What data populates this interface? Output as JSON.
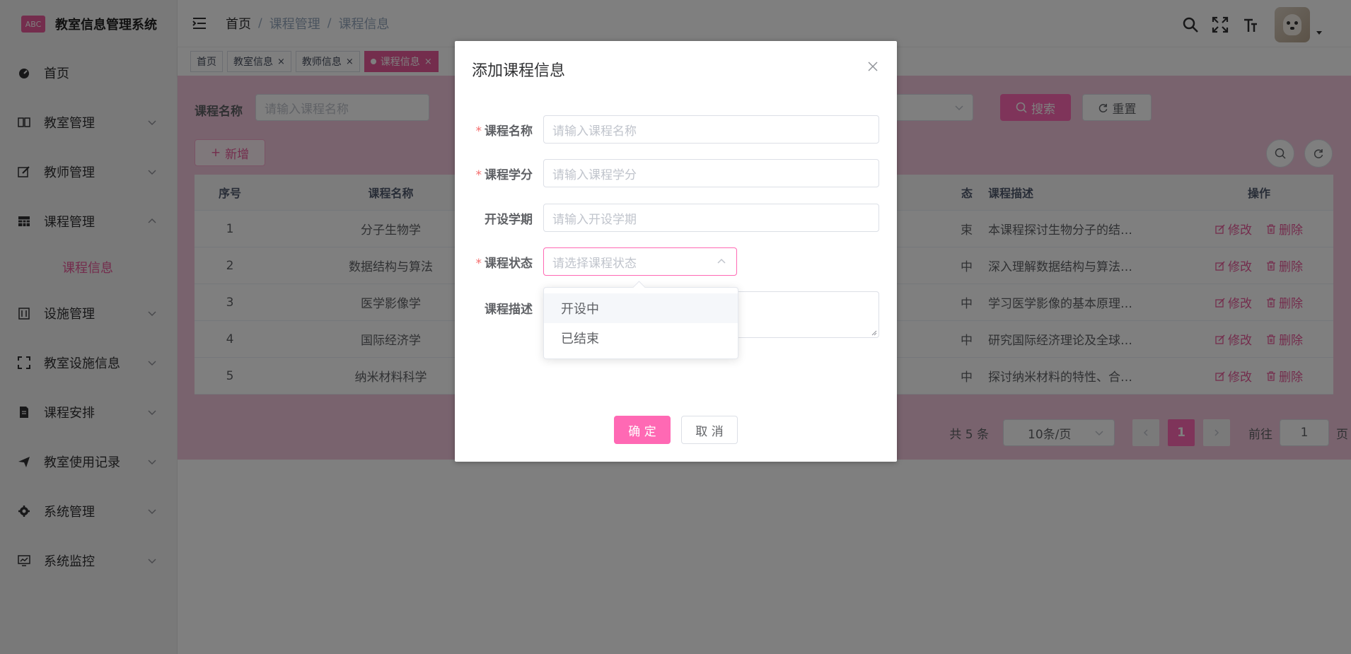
{
  "sidebar": {
    "logo_mark": "ABC",
    "title": "教室信息管理系统",
    "items": [
      {
        "label": "首页",
        "icon": "dashboard-icon"
      },
      {
        "label": "教室管理",
        "icon": "book-icon"
      },
      {
        "label": "教师管理",
        "icon": "edit-icon"
      },
      {
        "label": "课程管理",
        "icon": "table-icon"
      },
      {
        "label": "设施管理",
        "icon": "building-icon"
      },
      {
        "label": "教室设施信息",
        "icon": "fullscreen-icon"
      },
      {
        "label": "课程安排",
        "icon": "document-icon"
      },
      {
        "label": "教室使用记录",
        "icon": "send-icon"
      },
      {
        "label": "系统管理",
        "icon": "gear-icon"
      },
      {
        "label": "系统监控",
        "icon": "monitor-icon"
      }
    ],
    "submenu_active": "课程信息"
  },
  "navbar": {
    "breadcrumb": [
      "首页",
      "课程管理",
      "课程信息"
    ],
    "separator": "/"
  },
  "tags": [
    "首页",
    "教室信息",
    "教师信息",
    "课程信息"
  ],
  "tag_close": "×",
  "search": {
    "label": "课程名称",
    "placeholder": "请输入课程名称",
    "search_btn": "搜索",
    "reset_btn": "重置",
    "add_btn": "新增"
  },
  "table": {
    "columns": [
      "序号",
      "课程名称",
      "态",
      "课程描述",
      "操作"
    ],
    "rows": [
      {
        "no": "1",
        "name": "分子生物学",
        "status": "束",
        "desc": "本课程探讨生物分子的结…"
      },
      {
        "no": "2",
        "name": "数据结构与算法",
        "status": "中",
        "desc": "深入理解数据结构与算法…"
      },
      {
        "no": "3",
        "name": "医学影像学",
        "status": "中",
        "desc": "学习医学影像的基本原理…"
      },
      {
        "no": "4",
        "name": "国际经济学",
        "status": "中",
        "desc": "研究国际经济理论及全球…"
      },
      {
        "no": "5",
        "name": "纳米材料科学",
        "status": "中",
        "desc": "探讨纳米材料的特性、合…"
      }
    ],
    "edit_label": "修改",
    "delete_label": "删除"
  },
  "pagination": {
    "total": "共 5 条",
    "page_size": "10条/页",
    "current": "1",
    "goto_label": "前往",
    "goto_value": "1",
    "page_suffix": "页"
  },
  "dialog": {
    "title": "添加课程信息",
    "fields": [
      {
        "label": "课程名称",
        "placeholder": "请输入课程名称",
        "required": true
      },
      {
        "label": "课程学分",
        "placeholder": "请输入课程学分",
        "required": true
      },
      {
        "label": "开设学期",
        "placeholder": "请输入开设学期",
        "required": false
      },
      {
        "label": "课程状态",
        "placeholder": "请选择课程状态",
        "required": true
      },
      {
        "label": "课程描述",
        "placeholder": "",
        "required": false
      }
    ],
    "required_mark": "*",
    "status_options": [
      "开设中",
      "已结束"
    ],
    "confirm_btn": "确 定",
    "cancel_btn": "取 消"
  },
  "colors": {
    "accent": "#ff69b4",
    "accent_text": "#e85a9a"
  }
}
